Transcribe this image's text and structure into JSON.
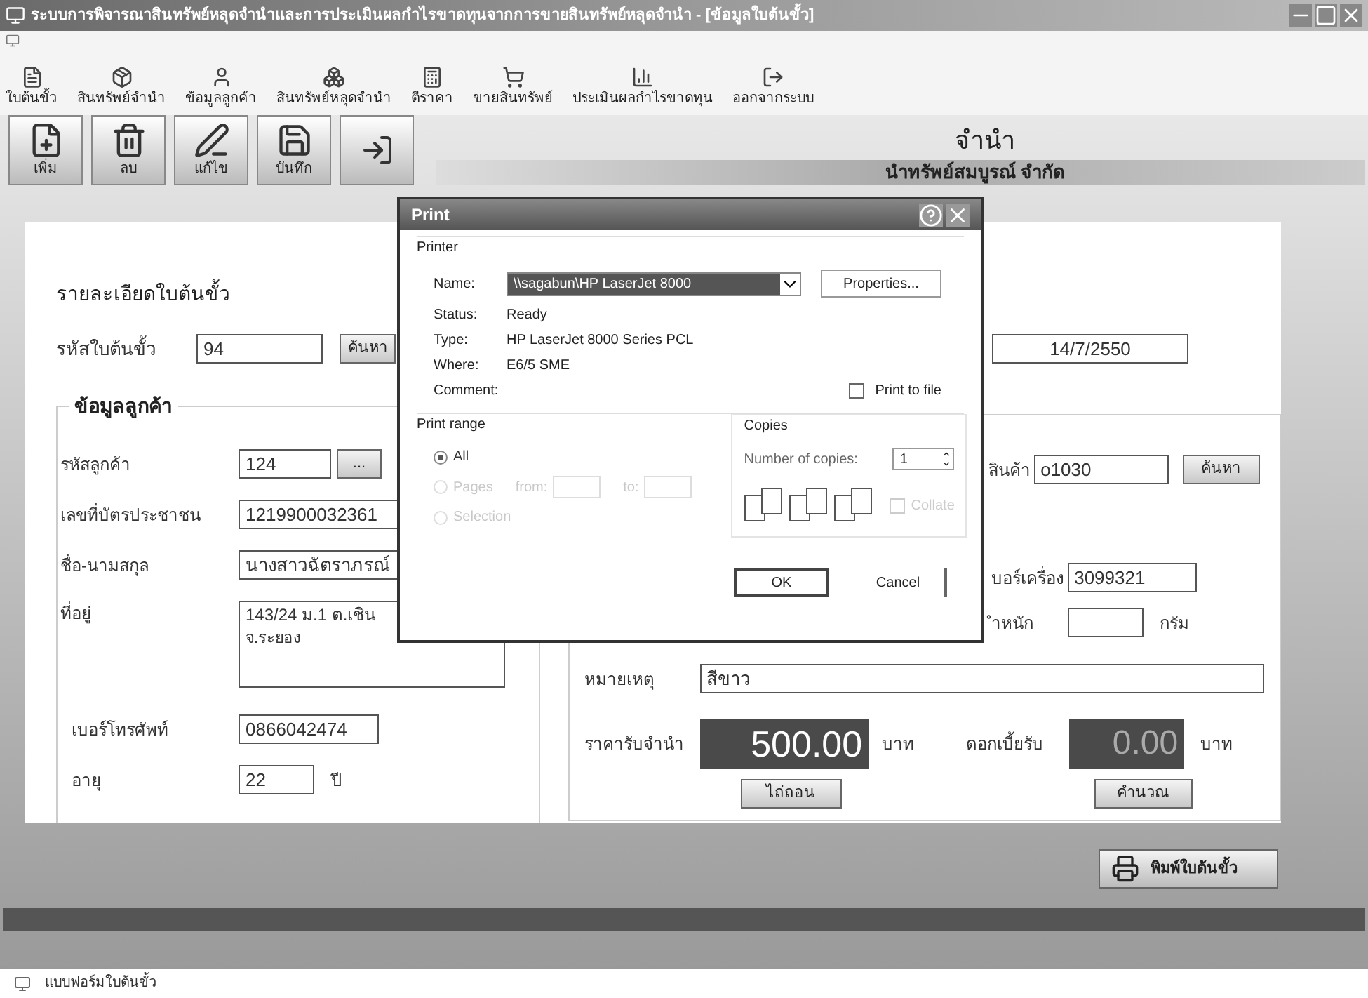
{
  "window": {
    "title": "ระบบการพิจารณาสินทรัพย์หลุดจำนำและการประเมินผลกำไรขาดทุนจากการขายสินทรัพย์หลุดจำนำ - [ข้อมูลใบต้นขั้ว]"
  },
  "toolbar": [
    {
      "label": "ใบต้นขั้ว"
    },
    {
      "label": "สินทรัพย์จำนำ"
    },
    {
      "label": "ข้อมูลลูกค้า"
    },
    {
      "label": "สินทรัพย์หลุดจำนำ"
    },
    {
      "label": "ตีราคา"
    },
    {
      "label": "ขายสินทรัพย์"
    },
    {
      "label": "ประเมินผลกำไรขาดทุน"
    },
    {
      "label": "ออกจากระบบ"
    }
  ],
  "action_buttons": [
    {
      "label": "เพิ่ม"
    },
    {
      "label": "ลบ"
    },
    {
      "label": "แก้ไข"
    },
    {
      "label": "บันทึก"
    }
  ],
  "header": {
    "title": "จำนำ",
    "company": "นำทรัพย์สมบูรณ์ จำกัด"
  },
  "form": {
    "heading": "รายละเอียดใบต้นขั้ว",
    "ticket_label": "รหัสใบต้นขั้ว",
    "ticket_value": "94",
    "search_button": "ค้นหา",
    "date_value": "14/7/2550"
  },
  "customer": {
    "title": "ข้อมูลลูกค้า",
    "fields": [
      {
        "kind": "lookup",
        "label": "รหัสลูกค้า",
        "value": "124",
        "button": "..."
      },
      {
        "kind": "text",
        "label": "เลขที่บัตรประชาชน",
        "value": "1219900032361"
      },
      {
        "kind": "text",
        "label": "ชื่อ-นามสกุล",
        "value": "นางสาวฉัตราภรณ์"
      },
      {
        "kind": "area",
        "label": "ที่อยู่",
        "value": "143/24 ม.1 ต.เชิน",
        "value2": "จ.ระยอง"
      },
      {
        "kind": "short",
        "label": "เบอร์โทรศัพท์",
        "value": "0866042474"
      },
      {
        "kind": "tiny",
        "label": "อายุ",
        "value": "22",
        "suffix": "ปี"
      }
    ]
  },
  "asset": {
    "product_label": "สินค้า",
    "product_value": "o1030",
    "product_button": "ค้นหา",
    "serial_label": "บอร์เครื่อง",
    "serial_value": "3099321",
    "weight_label": "ำหนัก",
    "weight_unit": "กรัม",
    "note_label": "หมายเหตุ",
    "note_value": "สีขาว",
    "price_label": "ราคารับจำนำ",
    "price_value": "500.00",
    "price_unit": "บาท",
    "interest_label": "ดอกเบี้ยรับ",
    "interest_value": "0.00",
    "interest_unit": "บาท",
    "redeem_button": "ไถ่ถอน",
    "calc_button": "คำนวณ"
  },
  "print_button": "พิมพ์ใบต้นขั้ว",
  "status_bar": "แบบฟอร์มใบต้นขั้ว",
  "print_dialog": {
    "title": "Print",
    "printer_group": "Printer",
    "name_label": "Name:",
    "name_value": "\\\\sagabun\\HP LaserJet 8000",
    "properties_button": "Properties...",
    "info": [
      {
        "label": "Status:",
        "value": "Ready"
      },
      {
        "label": "Type:",
        "value": "HP LaserJet 8000 Series PCL"
      },
      {
        "label": "Where:",
        "value": "E6/5 SME"
      },
      {
        "label": "Comment:"
      }
    ],
    "print_to_file": {
      "label": "Print to file",
      "checked": false
    },
    "range_group": "Print range",
    "range_options": [
      {
        "label": "All",
        "selected": true,
        "disabled": false
      },
      {
        "label": "Pages",
        "selected": false,
        "disabled": true
      },
      {
        "label": "Selection",
        "selected": false,
        "disabled": true
      }
    ],
    "from_label": "from:",
    "to_label": "to:",
    "copies_group": "Copies",
    "copies_label": "Number of copies:",
    "copies_value": "1",
    "collate": {
      "label": "Collate",
      "checked": false,
      "disabled": true
    },
    "ok_button": "OK",
    "cancel_button": "Cancel"
  }
}
